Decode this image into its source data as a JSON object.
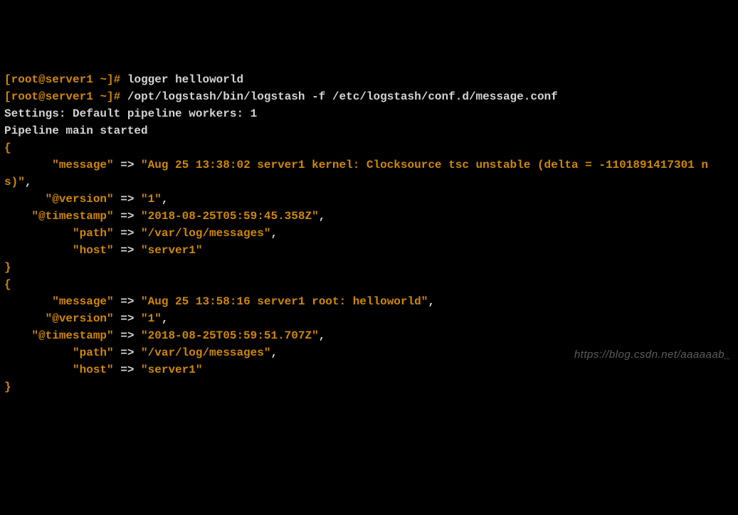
{
  "prompt": {
    "open_bracket": "[",
    "user": "root",
    "at": "@",
    "host": "server1",
    "path": " ~",
    "close_bracket": "]",
    "symbol": "# "
  },
  "commands": {
    "cmd1": "logger helloworld",
    "cmd2": "/opt/logstash/bin/logstash -f /etc/logstash/conf.d/message.conf"
  },
  "output": {
    "settings": "Settings: Default pipeline workers: 1",
    "pipeline": "Pipeline main started"
  },
  "events": [
    {
      "message_key": "\"message\"",
      "message_val": "\"Aug 25 13:38:02 server1 kernel: Clocksource tsc unstable (delta = -1101891417301 ns)\"",
      "version_key": "\"@version\"",
      "version_val": "\"1\"",
      "timestamp_key": "\"@timestamp\"",
      "timestamp_val": "\"2018-08-25T05:59:45.358Z\"",
      "path_key": "\"path\"",
      "path_val": "\"/var/log/messages\"",
      "host_key": "\"host\"",
      "host_val": "\"server1\""
    },
    {
      "message_key": "\"message\"",
      "message_val": "\"Aug 25 13:58:16 server1 root: helloworld\"",
      "version_key": "\"@version\"",
      "version_val": "\"1\"",
      "timestamp_key": "\"@timestamp\"",
      "timestamp_val": "\"2018-08-25T05:59:51.707Z\"",
      "path_key": "\"path\"",
      "path_val": "\"/var/log/messages\"",
      "host_key": "\"host\"",
      "host_val": "\"server1\""
    }
  ],
  "arrow": " => ",
  "comma": ",",
  "brace_open": "{",
  "brace_close": "}",
  "watermark": "https://blog.csdn.net/aaaaaab_"
}
